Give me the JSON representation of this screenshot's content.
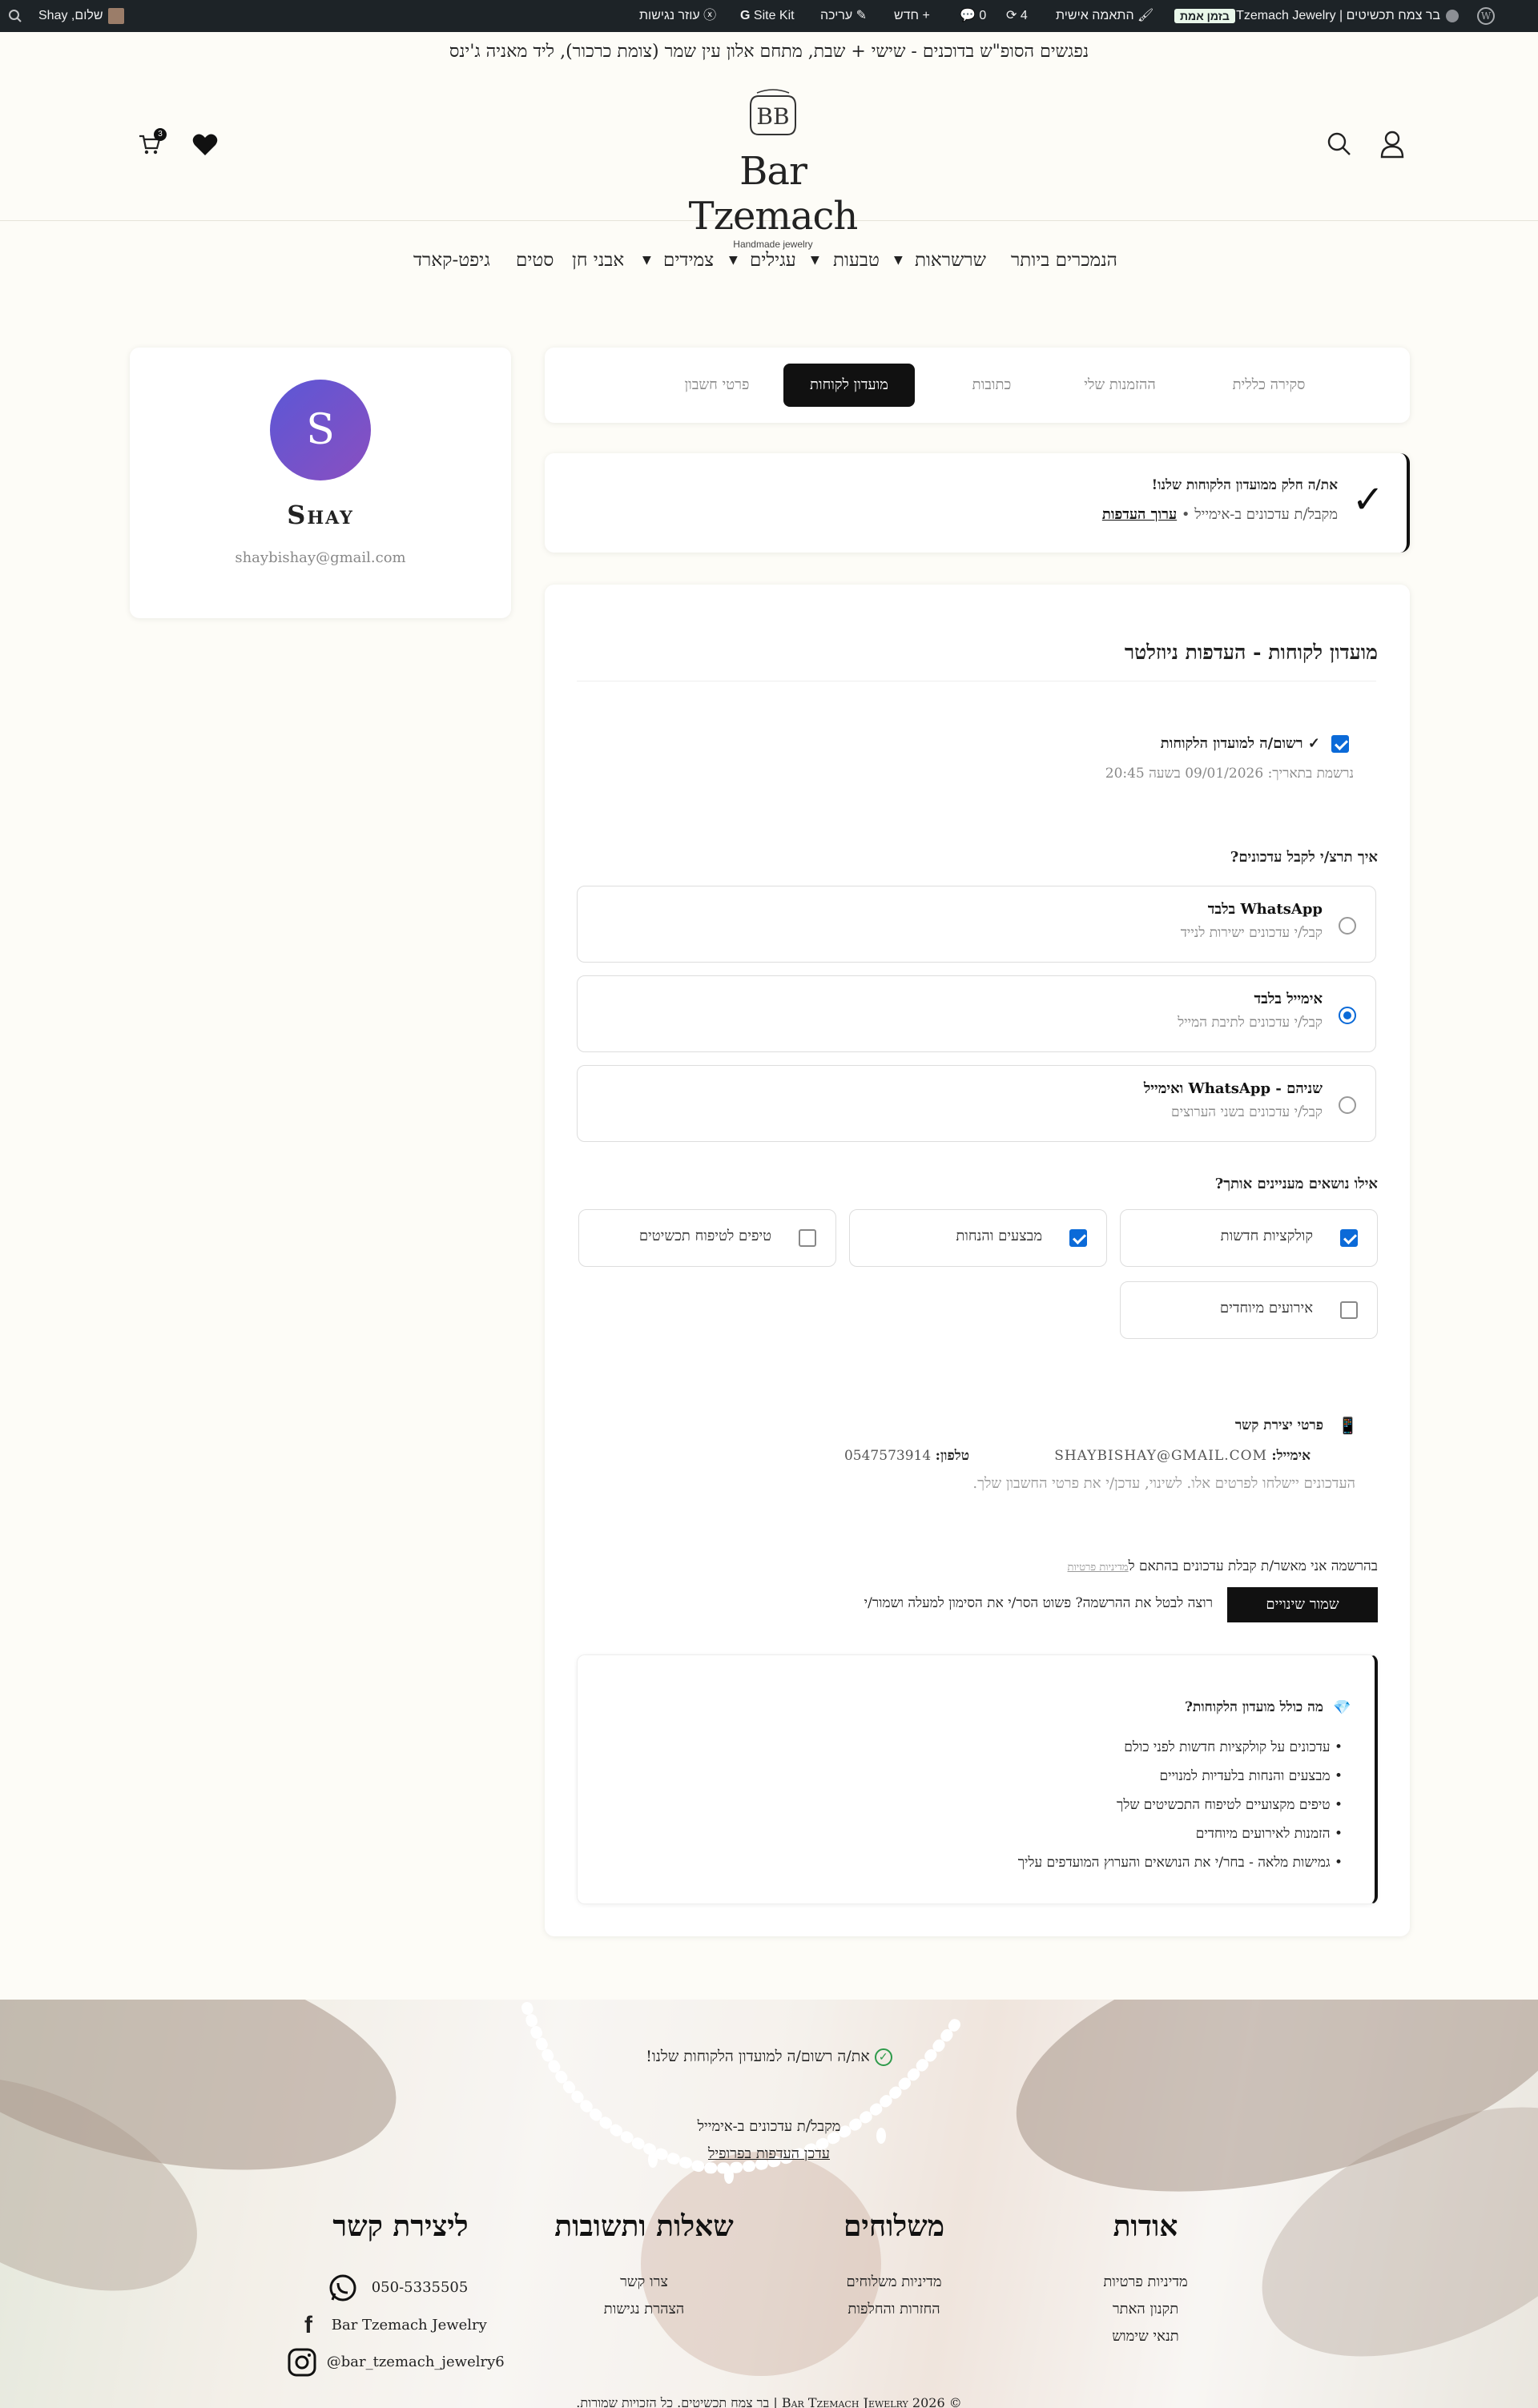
{
  "admin_bar": {
    "site_name": "בר צמח תכשיטים | Bar Tzemach Jewelry",
    "env_badge": "בזמן אמת",
    "customize": "התאמה אישית",
    "updates_count": "4",
    "comments_count": "0",
    "new_label": "חדש",
    "edit_label": "עריכה",
    "sitekit_label": "Site Kit",
    "accessibility_label": "עוזר נגישות",
    "greeting": "שלום, Shay"
  },
  "announcement": "נפגשים הסופ\"ש בדוכנים - שישי + שבת, מתחם אלון עין שמר (צומת כרכור), ליד מאניה ג'ינס",
  "header": {
    "brand": "Bar Tzemach",
    "tagline": "Handmade jewelry",
    "cart_count": "3"
  },
  "nav": {
    "items": [
      "הנמכרים ביותר",
      "שרשראות",
      "טבעות",
      "עגילים",
      "צמידים",
      "אבני חן",
      "סטים",
      "גיפט-קארד"
    ]
  },
  "profile": {
    "avatar_letter": "S",
    "name": "Shay",
    "email": "shaybishay@gmail.com"
  },
  "account_tabs": [
    "סקירה כללית",
    "ההזמנות שלי",
    "כתובות",
    "מועדון לקוחות",
    "פרטי חשבון"
  ],
  "member_banner": {
    "title": "את/ה חלק ממועדון הלקוחות שלנו!",
    "status": "מקבל/ת עדכונים ב-אימייל •",
    "edit_link": "ערוך העדפות"
  },
  "prefs": {
    "heading": "מועדון לקוחות - העדפות ניוזלטר",
    "registered_label": "✓ רשום/ה למועדון הלקוחות",
    "registered_date": "נרשמת בתאריך: 09/01/2026 בשעה 20:45",
    "how_question": "איך תרצ/י לקבל עדכונים?",
    "options": [
      {
        "title": "WhatsApp בלבד",
        "sub": "קבל/י עדכונים ישירות לנייד"
      },
      {
        "title": "אימייל בלבד",
        "sub": "קבל/י עדכונים לתיבת המייל"
      },
      {
        "title": "שניהם - WhatsApp ואימייל",
        "sub": "קבל/י עדכונים בשני הערוצים"
      }
    ],
    "selected_option_index": 1,
    "topics_question": "אילו נושאים מעניינים אותך?",
    "topics": [
      {
        "label": "קולקציות חדשות",
        "checked": true
      },
      {
        "label": "מבצעים והנחות",
        "checked": true
      },
      {
        "label": "טיפים לטיפוח תכשיטים",
        "checked": false
      },
      {
        "label": "אירועים מיוחדים",
        "checked": false
      }
    ],
    "contact_heading": "פרטי יצירת קשר",
    "email_key": "אימייל:",
    "email_value": "SHAYBISHAY@GMAIL.COM",
    "phone_key": "טלפון:",
    "phone_value": "0547573914",
    "contact_note": "העדכונים יישלחו לפרטים אלו. לשינוי, עדכן/י את פרטי החשבון שלך.",
    "consent_text": "בהרשמה אני מאשר/ת קבלת עדכונים בהתאם ל",
    "privacy_link": "מדיניות פרטיות",
    "save_button": "שמור שינויים",
    "unsubscribe_note": "רוצה לבטל את ההרשמה? פשוט הסר/י את הסימון למעלה ושמור/י"
  },
  "benefits": {
    "heading": "מה כולל מועדון הלקוחות?",
    "items": [
      "עדכונים על קולקציות חדשות לפני כולם",
      "מבצעים והנחות בלעדיות למנויים",
      "טיפים מקצועיים לטיפוח התכשיטים שלך",
      "הזמנות לאירועים מיוחדים",
      "גמישות מלאה - בחר/י את הנושאים והערוץ המועדפים עליך"
    ]
  },
  "footer": {
    "club_status": "את/ה רשום/ה למועדון הלקוחות שלנו!",
    "club_channel": "מקבל/ת עדכונים ב-אימייל",
    "club_edit": "עדכן העדפות בפרופיל",
    "columns": [
      {
        "title": "אודות",
        "links": [
          "מדיניות פרטיות",
          "תקנון האתר",
          "תנאי שימוש"
        ]
      },
      {
        "title": "משלוחים",
        "links": [
          "מדיניות משלוחים",
          "החזרות והחלפות"
        ]
      },
      {
        "title": "שאלות ותשובות",
        "links": [
          "צרו קשר",
          "הצהרת נגישות"
        ]
      },
      {
        "title": "ליצירת קשר",
        "links": [
          "050-5335505",
          "Bar Tzemach Jewelry",
          "@bar_tzemach_jewelry6"
        ]
      }
    ],
    "copyright": "© 2026 Bar Tzemach Jewelry | בר צמח תכשיטים. כל הזכויות שמורות."
  },
  "colors": {
    "accent": "#111111",
    "avatar_from": "#5b57d6",
    "avatar_to": "#8a4fc0",
    "checkbox": "#0b6ad8",
    "whatsapp_check": "#2e9a4a"
  }
}
